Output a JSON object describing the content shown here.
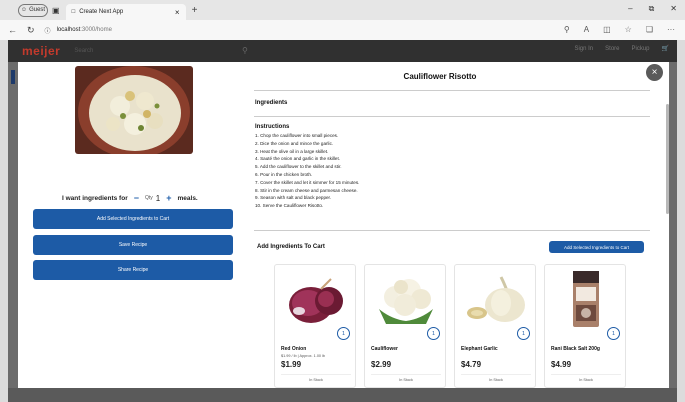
{
  "browser": {
    "profile_label": "Guest",
    "tab_title": "Create Next App",
    "url_host": "localhost",
    "url_path": ":3000/home"
  },
  "site": {
    "logo": "meijer",
    "search_placeholder": "Search",
    "header_links": [
      "Sign In",
      "Store",
      "Pickup"
    ]
  },
  "recipe": {
    "title": "Cauliflower Risotto",
    "ingredients_heading": "Ingredients",
    "instructions_heading": "Instructions",
    "steps": [
      "1. Chop the cauliflower into small pieces.",
      "2. Dice the onion and mince the garlic.",
      "3. Heat the olive oil in a large skillet.",
      "4. Sauté the onion and garlic in the skillet.",
      "5. Add the cauliflower to the skillet and stir.",
      "6. Pour in the chicken broth.",
      "7. Cover the skillet and let it simmer for 15 minutes.",
      "8. Stir in the cream cheese and parmesan cheese.",
      "9. Season with salt and black pepper.",
      "10. Serve the Cauliflower Risotto."
    ]
  },
  "left_panel": {
    "want_prefix": "I want ingredients for",
    "want_suffix": "meals.",
    "qty_label": "Qty",
    "qty_value": "1",
    "minus": "−",
    "plus": "+",
    "add_to_cart_label": "Add Selected Ingredients to Cart",
    "save_label": "Save Recipe",
    "share_label": "Share Recipe"
  },
  "cart_section": {
    "heading": "Add Ingredients To Cart",
    "button_label": "Add Selected Ingredients to Cart"
  },
  "products": [
    {
      "name": "Red Onion",
      "sub": "$1.99 / lb | Approx. 1.00 lb",
      "price": "$1.99",
      "qty": "1",
      "stock": "In Stock"
    },
    {
      "name": "Cauliflower",
      "sub": "",
      "price": "$2.99",
      "qty": "1",
      "stock": "In Stock"
    },
    {
      "name": "Elephant Garlic",
      "sub": "",
      "price": "$4.79",
      "qty": "1",
      "stock": "In Stock"
    },
    {
      "name": "Rani Black Salt 200g",
      "sub": "",
      "price": "$4.99",
      "qty": "1",
      "stock": "In Stock"
    }
  ],
  "colors": {
    "primary_button": "#1d5ba6",
    "brand_red": "#c33a2c",
    "overlay": "#303030"
  }
}
